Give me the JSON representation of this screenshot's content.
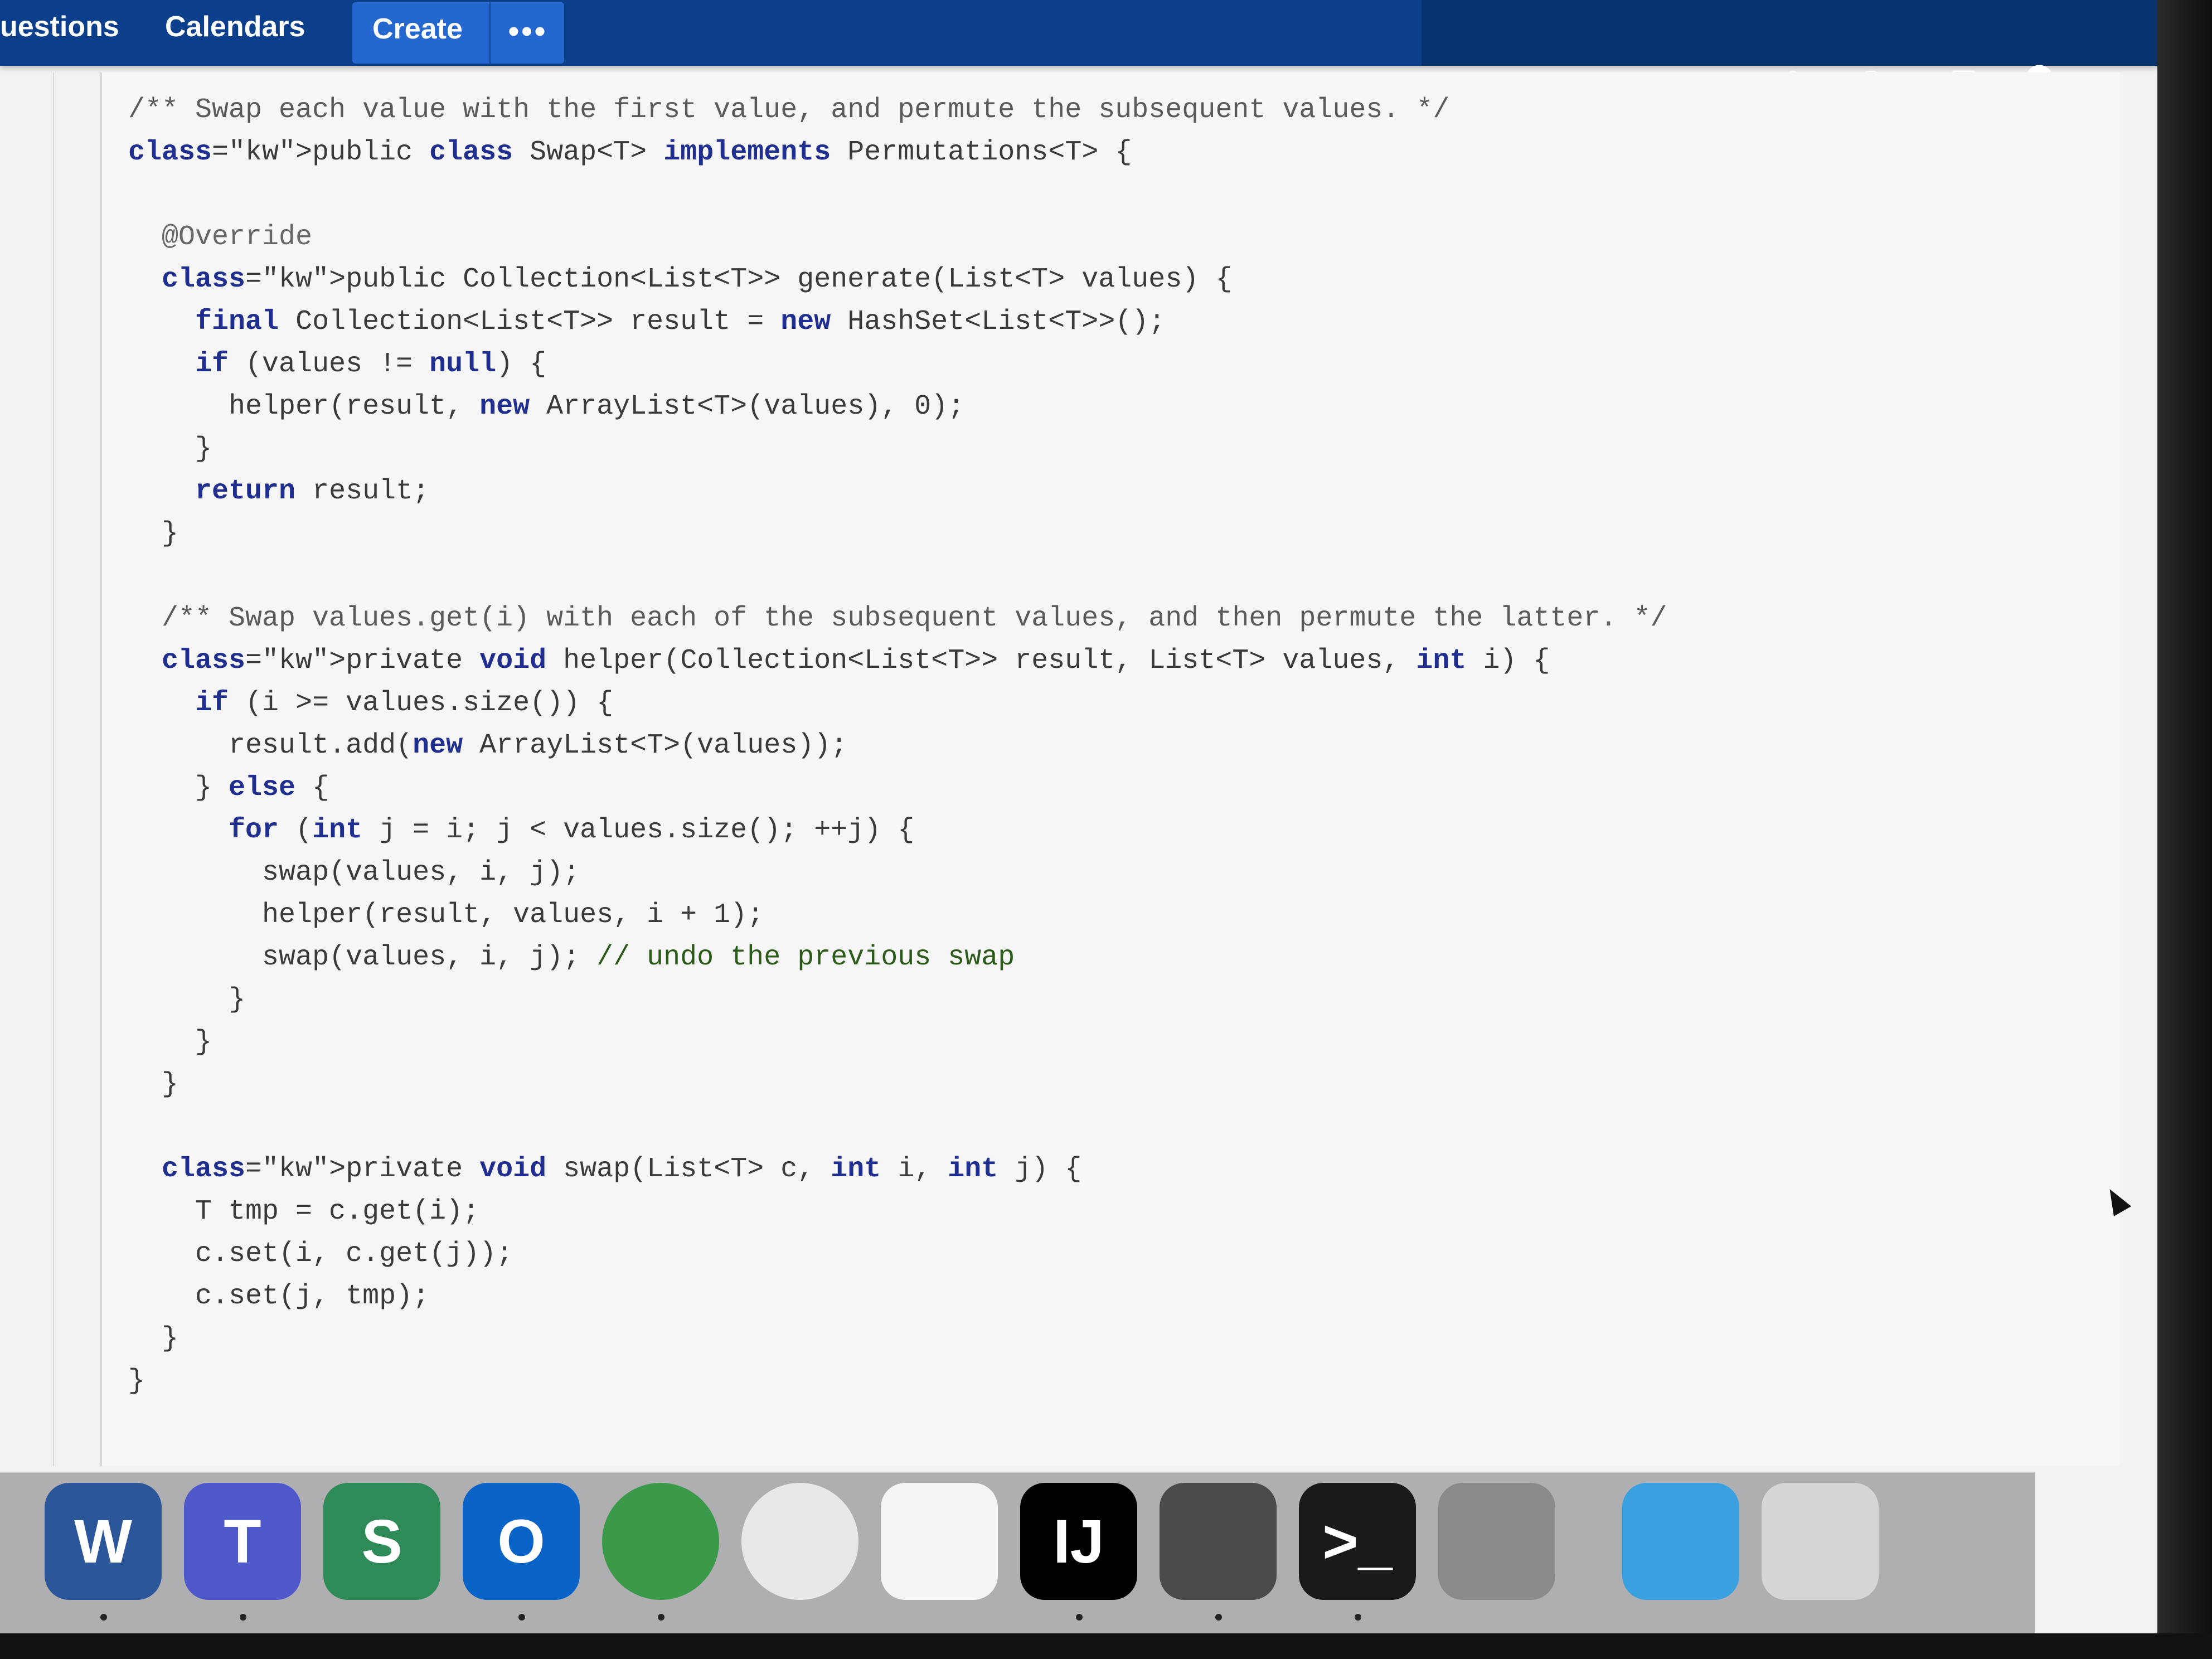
{
  "nav": {
    "questions": "uestions",
    "calendars": "Calendars",
    "create": "Create",
    "more": "•••"
  },
  "icons": {
    "search": "search-icon",
    "help": "help-icon",
    "notifications": "notification-icon",
    "user": "user-icon"
  },
  "code": {
    "lines": [
      "/** Swap each value with the first value, and permute the subsequent values. */",
      "public class Swap<T> implements Permutations<T> {",
      "",
      "  @Override",
      "  public Collection<List<T>> generate(List<T> values) {",
      "    final Collection<List<T>> result = new HashSet<List<T>>();",
      "    if (values != null) {",
      "      helper(result, new ArrayList<T>(values), 0);",
      "    }",
      "    return result;",
      "  }",
      "",
      "  /** Swap values.get(i) with each of the subsequent values, and then permute the latter. */",
      "  private void helper(Collection<List<T>> result, List<T> values, int i) {",
      "    if (i >= values.size()) {",
      "      result.add(new ArrayList<T>(values));",
      "    } else {",
      "      for (int j = i; j < values.size(); ++j) {",
      "        swap(values, i, j);",
      "        helper(result, values, i + 1);",
      "        swap(values, i, j); // undo the previous swap",
      "      }",
      "    }",
      "  }",
      "",
      "  private void swap(List<T> c, int i, int j) {",
      "    T tmp = c.get(i);",
      "    c.set(i, c.get(j));",
      "    c.set(j, tmp);",
      "  }",
      "}"
    ]
  },
  "dock": {
    "apps": [
      {
        "name": "word",
        "label": "W",
        "color": "#2b579a"
      },
      {
        "name": "teams",
        "label": "T",
        "color": "#5059c9"
      },
      {
        "name": "sway",
        "label": "S",
        "color": "#2e8b57"
      },
      {
        "name": "outlook",
        "label": "O",
        "color": "#0a64c8"
      },
      {
        "name": "vpn",
        "label": "",
        "color": "#3a9a4a"
      },
      {
        "name": "wifi",
        "label": "",
        "color": "#e8e8e8"
      },
      {
        "name": "slack",
        "label": "",
        "color": "#f4f4f4"
      },
      {
        "name": "intellij",
        "label": "IJ",
        "color": "#000000"
      },
      {
        "name": "sublime",
        "label": "",
        "color": "#4b4b4b"
      },
      {
        "name": "terminal",
        "label": ">_",
        "color": "#1a1a1a"
      },
      {
        "name": "system-preferences",
        "label": "",
        "color": "#8a8a8a"
      },
      {
        "name": "downloads-folder",
        "label": "",
        "color": "#3aa0e0"
      },
      {
        "name": "trash",
        "label": "",
        "color": "#d6d6d6"
      }
    ]
  }
}
